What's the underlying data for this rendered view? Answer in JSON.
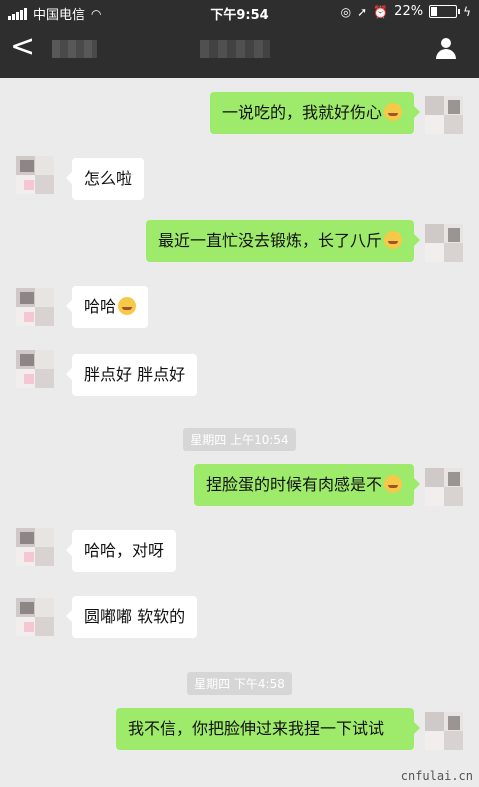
{
  "status": {
    "carrier": "中国电信",
    "time": "下午9:54",
    "battery": "22%"
  },
  "nav": {
    "back_glyph": "<"
  },
  "messages": [
    {
      "side": "out",
      "text": "一说吃的，我就好伤心",
      "emoji": "crying-laughing"
    },
    {
      "side": "in",
      "text": "怎么啦"
    },
    {
      "side": "out",
      "text": "最近一直忙没去锻炼，长了八斤",
      "emoji": "rolling-laughing"
    },
    {
      "side": "in",
      "text": "哈哈",
      "emoji": "grinning"
    },
    {
      "side": "in",
      "text": "胖点好 胖点好"
    },
    {
      "timestamp": "星期四 上午10:54"
    },
    {
      "side": "out",
      "text": "捏脸蛋的时候有肉感是不",
      "emoji": "smirking"
    },
    {
      "side": "in",
      "text": "哈哈，对呀"
    },
    {
      "side": "in",
      "text": "圆嘟嘟 软软的"
    },
    {
      "timestamp": "星期四 下午4:58"
    },
    {
      "side": "out",
      "text": "我不信，你把脸伸过来我捏一下试试"
    }
  ],
  "watermark": "cnfulai.cn"
}
